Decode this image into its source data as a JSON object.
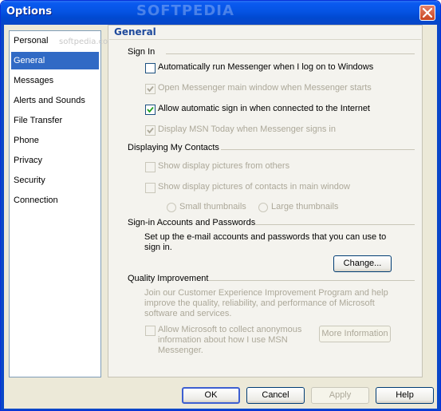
{
  "window": {
    "title": "Options",
    "watermark": "SOFTPEDIA"
  },
  "nav": {
    "ghost_text": "softpedia.com",
    "items": [
      {
        "label": "Personal"
      },
      {
        "label": "General"
      },
      {
        "label": "Messages"
      },
      {
        "label": "Alerts and Sounds"
      },
      {
        "label": "File Transfer"
      },
      {
        "label": "Phone"
      },
      {
        "label": "Privacy"
      },
      {
        "label": "Security"
      },
      {
        "label": "Connection"
      }
    ],
    "selected": "General"
  },
  "panel": {
    "title": "General",
    "sign_in": {
      "heading": "Sign In",
      "options": [
        {
          "label": "Automatically run Messenger when I log on to Windows",
          "checked": false,
          "enabled": true
        },
        {
          "label": "Open Messenger main window when Messenger starts",
          "checked": true,
          "enabled": false
        },
        {
          "label": "Allow automatic sign in when connected to the Internet",
          "checked": true,
          "enabled": true
        },
        {
          "label": "Display MSN Today when Messenger signs in",
          "checked": true,
          "enabled": false
        }
      ]
    },
    "contacts": {
      "heading": "Displaying My Contacts",
      "options": [
        {
          "label": "Show display pictures from others",
          "checked": false,
          "enabled": false
        },
        {
          "label": "Show display pictures of contacts in main window",
          "checked": false,
          "enabled": false
        }
      ],
      "radios": [
        "Small thumbnails",
        "Large thumbnails"
      ]
    },
    "accounts": {
      "heading": "Sign-in Accounts and Passwords",
      "text_line1": "Set up the e-mail accounts and passwords that you can use to",
      "text_line2": "sign in.",
      "button": "Change..."
    },
    "quality": {
      "heading": "Quality Improvement",
      "text_line1": "Join our Customer Experience Improvement Program and help",
      "text_line2": "improve the quality, reliability, and performance of Microsoft",
      "text_line3": "software and services.",
      "option_line1": "Allow Microsoft to collect anonymous",
      "option_line2": "information about how I use MSN",
      "option_line3": "Messenger.",
      "button": "More Information"
    }
  },
  "footer": {
    "ok": "OK",
    "cancel": "Cancel",
    "apply": "Apply",
    "help": "Help"
  },
  "colors": {
    "title_bar": "#0553E3",
    "selection": "#316AC5",
    "section_title": "#1F4A9C"
  }
}
